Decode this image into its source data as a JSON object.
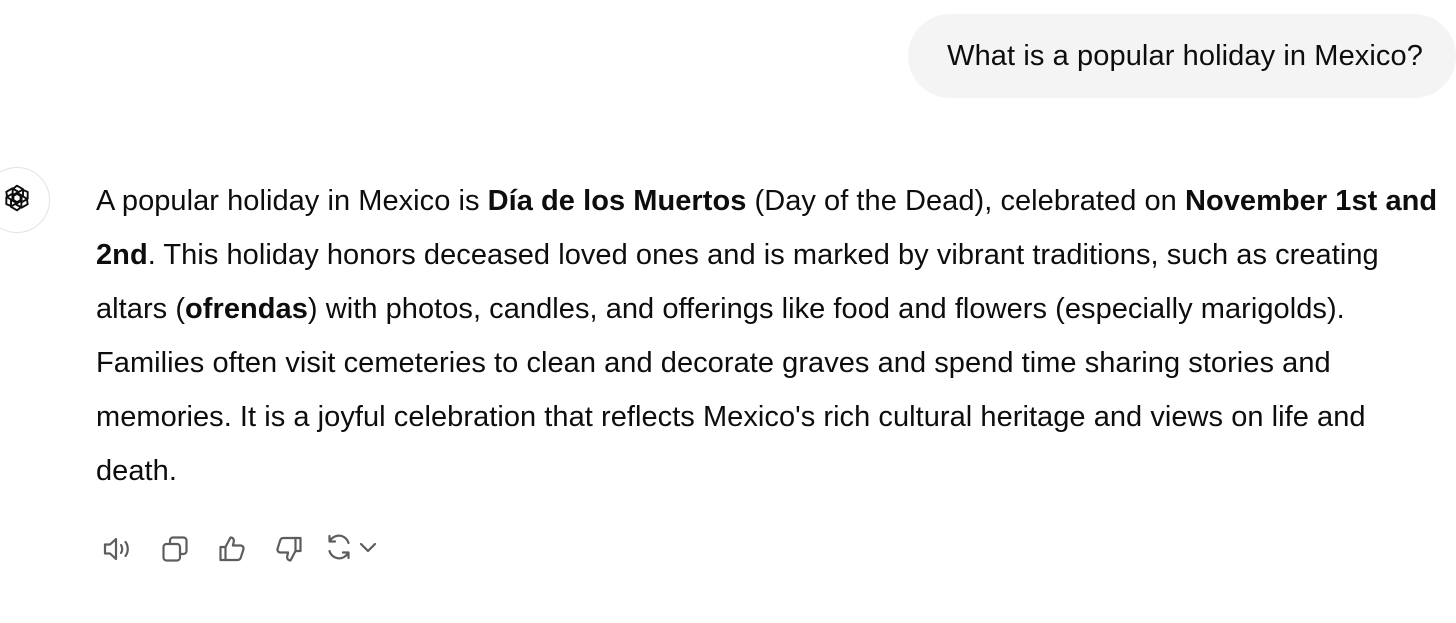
{
  "user_message": {
    "text": "What is a popular holiday in Mexico?"
  },
  "assistant_message": {
    "avatar_icon": "openai-logo-icon",
    "parts": {
      "p1": "A popular holiday in Mexico is ",
      "b1": "Día de los Muertos",
      "p2": " (Day of the Dead), celebrated on ",
      "b2": "November 1st and 2nd",
      "p3": ". This holiday honors deceased loved ones and is marked by vibrant traditions, such as creating altars (",
      "b3": "ofrendas",
      "p4": ") with photos, candles, and offerings like food and flowers (especially marigolds). Families often visit cemeteries to clean and decorate graves and spend time sharing stories and memories. It is a joyful celebration that reflects Mexico's rich cultural heritage and views on life and death."
    }
  },
  "actions": {
    "icons": [
      "read-aloud-icon",
      "copy-icon",
      "thumbs-up-icon",
      "thumbs-down-icon",
      "regenerate-icon",
      "chevron-down-icon"
    ]
  },
  "colors": {
    "bubble_bg": "#f4f4f4",
    "text": "#0d0d0d",
    "icon": "#5d5d5d",
    "avatar_border": "#e3e3e3"
  }
}
